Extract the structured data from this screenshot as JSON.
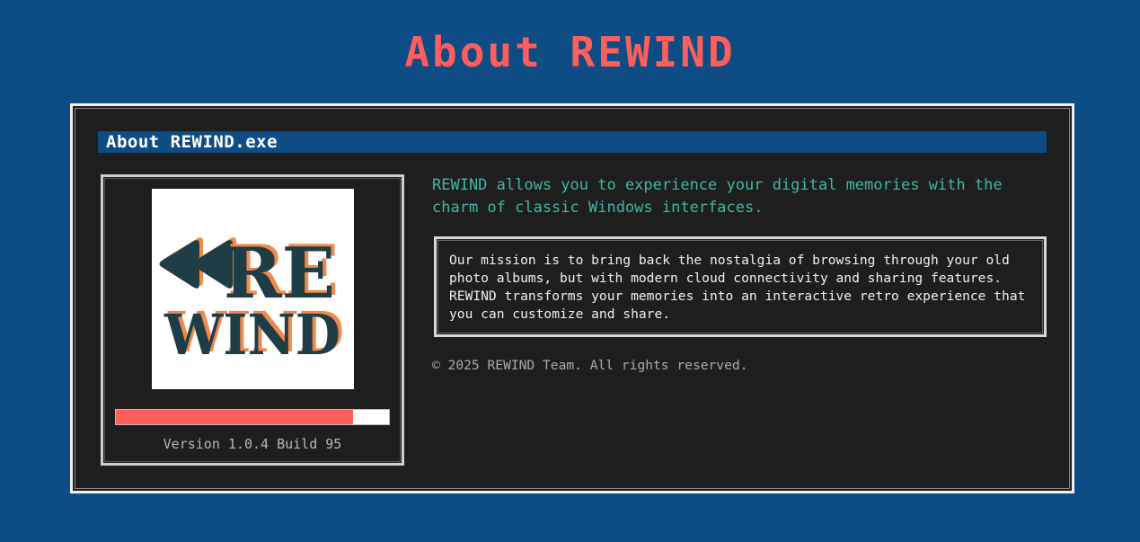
{
  "page": {
    "title": "About REWIND"
  },
  "window": {
    "title": "About REWIND.exe"
  },
  "logo": {
    "line1": "RE",
    "line2": "WIND",
    "colors": {
      "dark": "#1f3d46",
      "accent": "#f08a4b"
    },
    "icon": "rewind-icon"
  },
  "progress": {
    "value_fraction": 0.87,
    "color": "#ff5e5b"
  },
  "version": {
    "text": "Version 1.0.4 Build 95"
  },
  "content": {
    "intro": "REWIND allows you to experience your digital memories with the charm of classic Windows interfaces.",
    "mission": "Our mission is to bring back the nostalgia of browsing through your old photo albums, but with modern cloud connectivity and sharing features. REWIND transforms your memories into an interactive retro experience that you can customize and share.",
    "copyright": "© 2025 REWIND Team. All rights reserved."
  },
  "colors": {
    "background": "#0e4c85",
    "window_bg": "#1e1e1e",
    "title_accent": "#ff5e5b",
    "intro_text": "#3fb8a5"
  }
}
